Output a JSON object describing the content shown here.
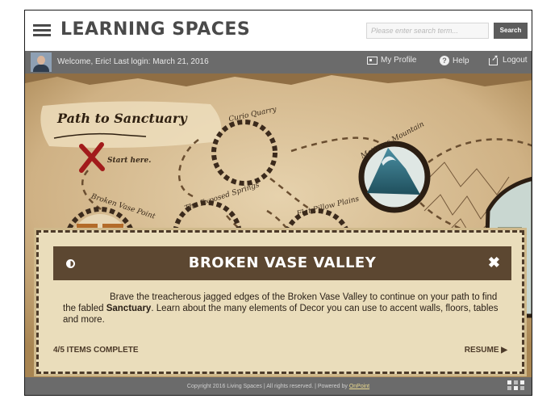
{
  "header": {
    "brand": "LEARNING SPACES",
    "search_placeholder": "Please enter search term...",
    "search_button": "Search"
  },
  "userbar": {
    "welcome": "Welcome, Eric!  Last login: March 21, 2016",
    "links": {
      "profile": "My Profile",
      "help": "Help",
      "logout": "Logout"
    }
  },
  "map": {
    "title": "Path to Sanctuary",
    "start_label": "Start here.",
    "locations": [
      "Curio Quarry",
      "Mattress Mountain",
      "The Exposed Springs",
      "Flat Pillow Plains",
      "Broken Vase Point"
    ]
  },
  "panel": {
    "title": "BROKEN VASE VALLEY",
    "description_before": "Brave the treacherous jagged edges of the Broken Vase Valley to continue on your path to find the fabled ",
    "description_bold": "Sanctuary",
    "description_after": ". Learn about the many elements of Decor you can use to accent walls, floors, tables and more.",
    "progress": "4/5 ITEMS COMPLETE",
    "resume": "RESUME ▶"
  },
  "footer": {
    "copyright": "Copyright 2016 Living Spaces | All rights reserved. | Powered by ",
    "powered_link": "OnPoint"
  },
  "colors": {
    "header_bar": "#6b6b6b",
    "panel_bar": "#5c4731",
    "parchment": "#eaddbb"
  }
}
